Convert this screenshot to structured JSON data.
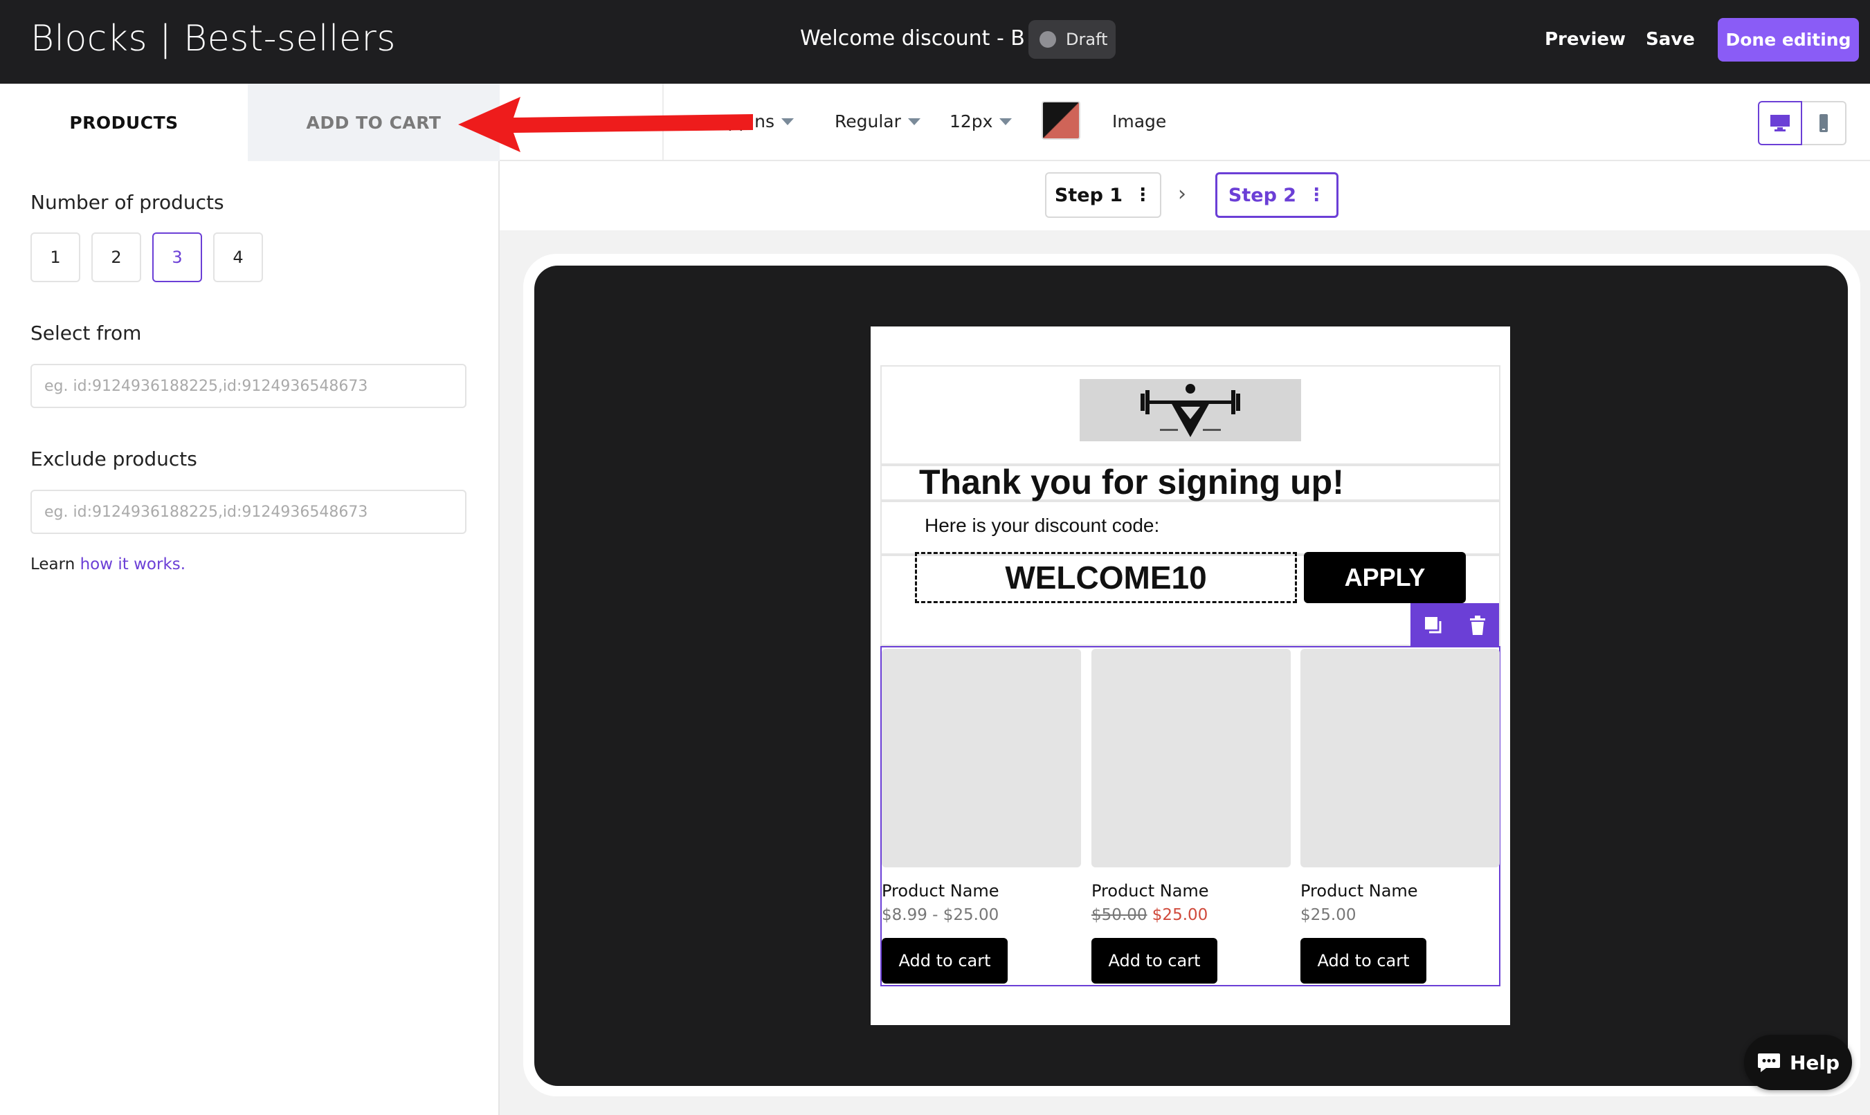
{
  "header": {
    "app_title": "Blocks | Best-sellers",
    "doc_title": "Welcome discount - B",
    "status_badge": "Draft",
    "preview_label": "Preview",
    "save_label": "Save",
    "done_label": "Done editing",
    "accent_color": "#8a5cf6"
  },
  "left_panel": {
    "tabs": [
      {
        "label": "PRODUCTS",
        "active": true
      },
      {
        "label": "ADD TO CART",
        "active": false
      }
    ],
    "number_of_products": {
      "label": "Number of products",
      "options": [
        "1",
        "2",
        "3",
        "4"
      ],
      "selected": "3"
    },
    "select_from": {
      "label": "Select from",
      "placeholder": "eg. id:9124936188225,id:9124936548673"
    },
    "exclude_products": {
      "label": "Exclude products",
      "placeholder": "eg. id:9124936188225,id:9124936548673"
    },
    "learn": {
      "prefix": "Learn",
      "link": "how it works."
    }
  },
  "toolbar": {
    "font_family": "Poppins",
    "font_weight": "Regular",
    "font_size": "12px",
    "color_swatch": [
      "#141414",
      "#cf6458"
    ],
    "image_label": "Image",
    "device_selected": "desktop"
  },
  "steps": [
    {
      "label": "Step 1",
      "active": false
    },
    {
      "label": "Step 2",
      "active": true
    }
  ],
  "popup": {
    "heading": "Thank you for signing up!",
    "subheading": "Here is your discount code:",
    "discount_code": "WELCOME10",
    "apply_label": "APPLY",
    "products": [
      {
        "name": "Product Name",
        "price": "$8.99 - $25.00",
        "old_price": "",
        "sale_price": "",
        "button": "Add to cart"
      },
      {
        "name": "Product Name",
        "price": "",
        "old_price": "$50.00",
        "sale_price": "$25.00",
        "button": "Add to cart"
      },
      {
        "name": "Product Name",
        "price": "$25.00",
        "old_price": "",
        "sale_price": "",
        "button": "Add to cart"
      }
    ]
  },
  "help": {
    "label": "Help"
  }
}
